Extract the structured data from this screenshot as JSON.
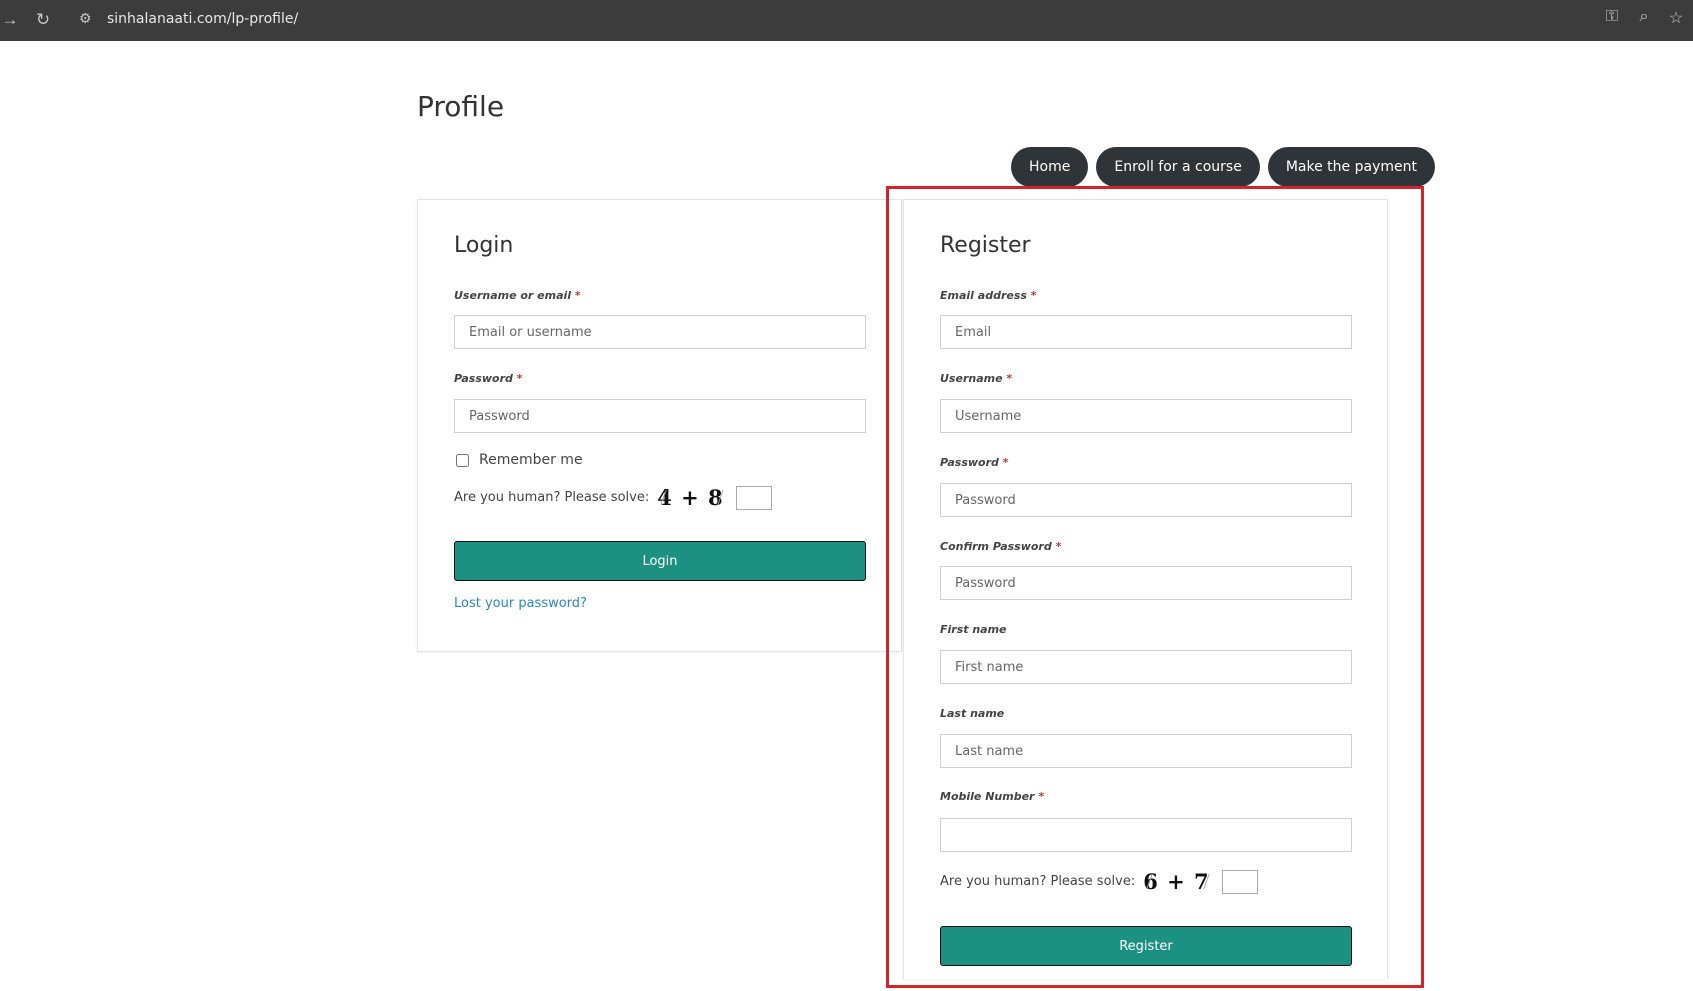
{
  "browser": {
    "url": "sinhalanaati.com/lp-profile/"
  },
  "page": {
    "title": "Profile"
  },
  "nav": {
    "home": "Home",
    "enroll": "Enroll for a course",
    "payment": "Make the payment"
  },
  "login": {
    "title": "Login",
    "username_label": "Username or email",
    "username_placeholder": "Email or username",
    "password_label": "Password",
    "password_placeholder": "Password",
    "remember_label": "Remember me",
    "captcha_text": "Are you human? Please solve:",
    "captcha_challenge": "4 + 8",
    "submit_label": "Login",
    "lost_password": "Lost your password?"
  },
  "register": {
    "title": "Register",
    "email_label": "Email address",
    "email_placeholder": "Email",
    "username_label": "Username",
    "username_placeholder": "Username",
    "password_label": "Password",
    "password_placeholder": "Password",
    "confirm_label": "Confirm Password",
    "confirm_placeholder": "Password",
    "first_name_label": "First name",
    "first_name_placeholder": "First name",
    "last_name_label": "Last name",
    "last_name_placeholder": "Last name",
    "mobile_label": "Mobile Number",
    "mobile_placeholder": "",
    "captcha_text": "Are you human? Please solve:",
    "captcha_challenge": "6 + 7",
    "submit_label": "Register"
  },
  "colors": {
    "accent": "#1c9081",
    "nav_pill": "#2f3438",
    "highlight": "#d4232a",
    "link": "#2a86c9"
  }
}
